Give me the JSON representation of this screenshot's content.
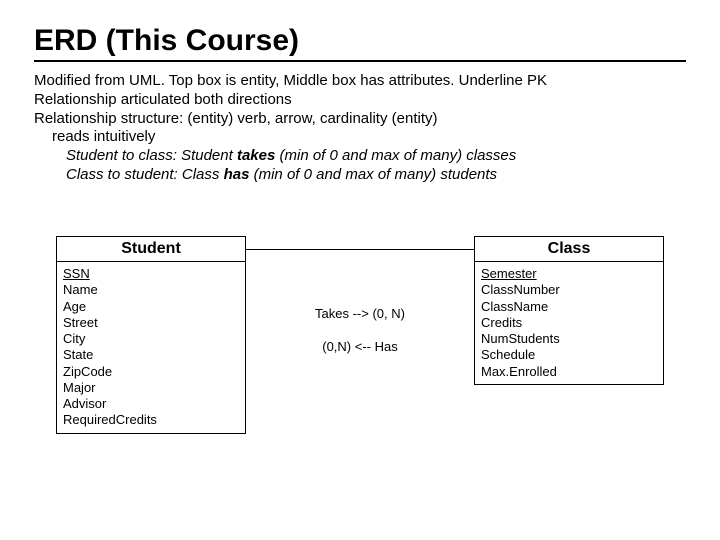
{
  "title": "ERD (This Course)",
  "bullets": {
    "b1": "Modified from UML. Top box is entity, Middle box has attributes. Underline PK",
    "b2": "Relationship articulated both directions",
    "b3": "Relationship structure: (entity) verb, arrow, cardinality (entity)",
    "b4": "reads intuitively",
    "b5a": "Student to class: Student ",
    "b5b": "takes",
    "b5c": " (min of 0 and max of many) classes",
    "b6a": "Class to student: Class ",
    "b6b": "has",
    "b6c": " (min of 0 and max of many) students"
  },
  "student": {
    "name": "Student",
    "attrs": [
      "SSN",
      "Name",
      "Age",
      "Street",
      "City",
      "State",
      "ZipCode",
      "Major",
      "Advisor",
      "RequiredCredits"
    ]
  },
  "classEntity": {
    "name": "Class",
    "attrs": [
      "Semester",
      "ClassNumber",
      "ClassName",
      "Credits",
      "NumStudents",
      "Schedule",
      "Max.Enrolled"
    ]
  },
  "rel": {
    "takes": "Takes --> (0, N)",
    "has": "(0,N) <-- Has"
  }
}
